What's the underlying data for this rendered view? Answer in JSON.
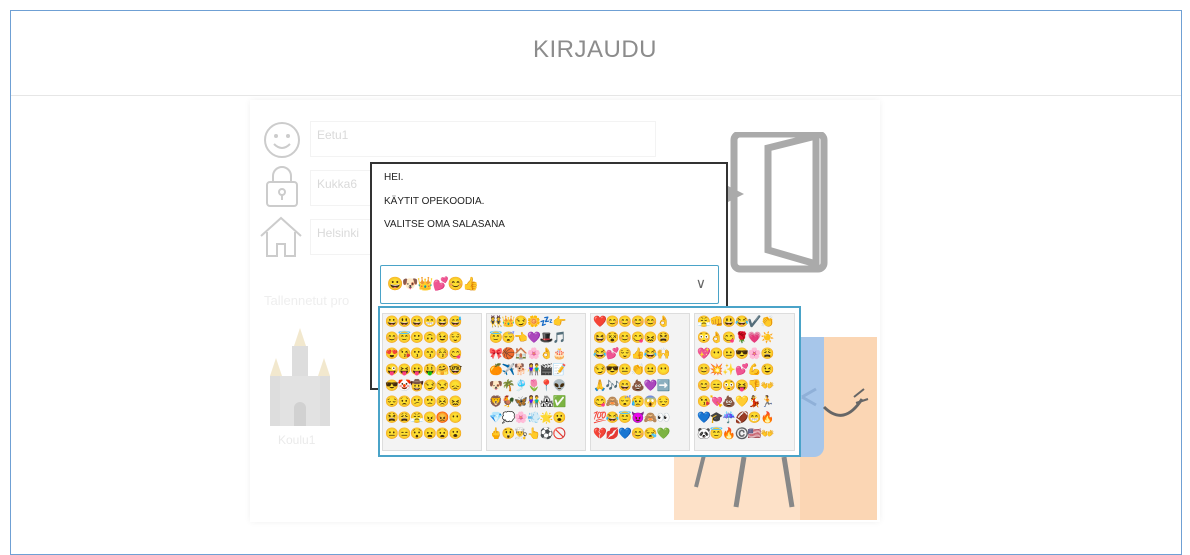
{
  "page": {
    "title": "KIRJAUDU"
  },
  "login": {
    "username": "Eetu1",
    "password": "Kukka6",
    "city": "Helsinki",
    "saved_label": "Tallennetut pro",
    "saved_profile": "Koulu1"
  },
  "dialog": {
    "line1": "HEI.",
    "line2": "KÄYTIT OPEKOODIA.",
    "line3": "VALITSE OMA SALASANA"
  },
  "select": {
    "value": "😀🐶👑💕😊👍"
  },
  "picker": {
    "panels": [
      [
        "😀😃😄😁😆😅",
        "😊😇🙂🙃😉😌",
        "😍😘😗😙😚😋",
        "😜😝😛🤑🤗🤓",
        "😎🤡🤠😏😒😞",
        "😔😟😕🙁😣😖",
        "😫😩😤😠😡😶",
        "😐😑😯😦😧😮"
      ],
      [
        "👯👑😏🌼💤👉",
        "😇😴👈💜🎩🎵",
        "🎀🏀🏠🌸👌🎂",
        "🍊✈️🐕👫🎬📝",
        "🐶🌴🎐🌷📍👽",
        "🦁🐓🦋👫🏘✅",
        "💎💭🌸💨🌟😮",
        "🖕😲👨‍🍳👆⚽🚫"
      ],
      [
        "❤️😊😊😊😊👌",
        "😆😵😊😋😖😫",
        "😂💕😌👍😂🙌",
        "😏😎😐👏😐😶",
        "🙏🎶😄💩💜➡️",
        "😋🙈😴😥😱😔",
        "💯😂😇😈🙈👀",
        "💔💋💙😊😪💚"
      ],
      [
        "😤👊😃😂✔️👏",
        "😳👌😋🌹💗☀️",
        "💖😶😐😎🌸😩",
        "😊💥✨💕💪😉",
        "😊😑😳😝👎👐",
        "😘💘💩💛💃🏃",
        "💙🎓☔🏈😁🔥",
        "🐼😇🔥©️🇺🇸👐"
      ]
    ]
  },
  "colors": {
    "accent": "#4aa3c8",
    "frame": "#6fa0d4",
    "title": "#8c8c8c"
  }
}
